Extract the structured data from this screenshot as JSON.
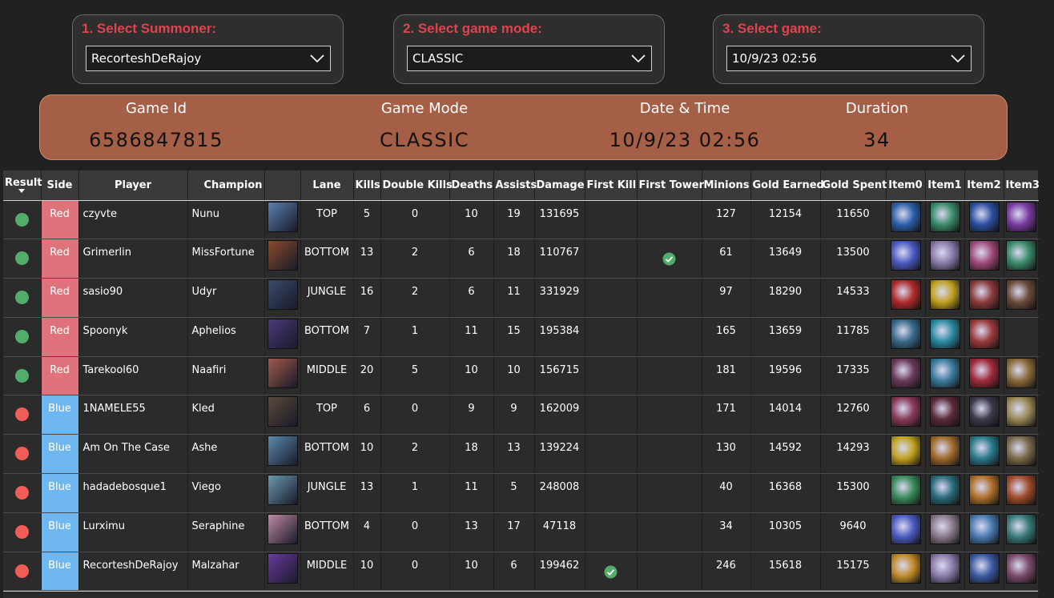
{
  "slicers": [
    {
      "label": "1. Select Summoner:",
      "value": "RecorteshDeRajoy"
    },
    {
      "label": "2. Select game mode:",
      "value": "CLASSIC"
    },
    {
      "label": "3. Select game:",
      "value": "10/9/23 02:56"
    }
  ],
  "info": {
    "game_id_label": "Game Id",
    "game_id": "6586847815",
    "mode_label": "Game Mode",
    "mode": "CLASSIC",
    "date_label": "Date & Time",
    "date": "10/9/23 02:56",
    "duration_label": "Duration",
    "duration": "34"
  },
  "columns": [
    "Result",
    "Side",
    "Player",
    "Champion",
    "",
    "Lane",
    "Kills",
    "Double Kills",
    "Deaths",
    "Assists",
    "Damage",
    "First Kill",
    "First Tower",
    "Minions",
    "Gold Earned",
    "Gold Spent",
    "Item0",
    "Item1",
    "Item2",
    "Item3"
  ],
  "colors": {
    "win": "#52ad6a",
    "loss": "#f05d56",
    "red_side": "#e0727b",
    "blue_side": "#6fb7f0",
    "banner": "#a65f47",
    "label_red": "#e0434d"
  },
  "rows": [
    {
      "result": "win",
      "side": "Red",
      "player": "czyvte",
      "champion": "Nunu",
      "champ_color": "#5a7fb0",
      "lane": "TOP",
      "kills": "5",
      "double_kills": "0",
      "deaths": "10",
      "assists": "19",
      "damage": "131695",
      "first_kill": false,
      "first_tower": false,
      "minions": "127",
      "gold_earned": "12154",
      "gold_spent": "11650",
      "items": [
        "#2b5fa8",
        "#3a8a6a",
        "#2a4ea0",
        "#7a3aa0"
      ]
    },
    {
      "result": "win",
      "side": "Red",
      "player": "Grimerlin",
      "champion": "MissFortune",
      "champ_color": "#8a4a2a",
      "lane": "BOTTOM",
      "kills": "13",
      "double_kills": "2",
      "deaths": "6",
      "assists": "18",
      "damage": "110767",
      "first_kill": false,
      "first_tower": true,
      "minions": "61",
      "gold_earned": "13649",
      "gold_spent": "13500",
      "items": [
        "#4a5ac0",
        "#8a7aa8",
        "#a04a7a",
        "#3a8a6a"
      ]
    },
    {
      "result": "win",
      "side": "Red",
      "player": "sasio90",
      "champion": "Udyr",
      "champ_color": "#3a4a6a",
      "lane": "JUNGLE",
      "kills": "16",
      "double_kills": "2",
      "deaths": "6",
      "assists": "11",
      "damage": "331929",
      "first_kill": false,
      "first_tower": false,
      "minions": "97",
      "gold_earned": "18290",
      "gold_spent": "14533",
      "items": [
        "#b02a2a",
        "#c0a020",
        "#8a3a3a",
        "#6a4a3a"
      ]
    },
    {
      "result": "win",
      "side": "Red",
      "player": "Spoonyk",
      "champion": "Aphelios",
      "champ_color": "#4a3a7a",
      "lane": "BOTTOM",
      "kills": "7",
      "double_kills": "1",
      "deaths": "11",
      "assists": "15",
      "damage": "195384",
      "first_kill": false,
      "first_tower": false,
      "minions": "165",
      "gold_earned": "13659",
      "gold_spent": "11785",
      "items": [
        "#3a6a8a",
        "#2a8aa0",
        "#9a3a3a",
        ""
      ]
    },
    {
      "result": "win",
      "side": "Red",
      "player": "Tarekool60",
      "champion": "Naafiri",
      "champ_color": "#a05a4a",
      "lane": "MIDDLE",
      "kills": "20",
      "double_kills": "5",
      "deaths": "10",
      "assists": "10",
      "damage": "156715",
      "first_kill": false,
      "first_tower": false,
      "minions": "181",
      "gold_earned": "19596",
      "gold_spent": "17335",
      "items": [
        "#6a3a5a",
        "#3a7a9a",
        "#a02a3a",
        "#8a6a3a"
      ]
    },
    {
      "result": "loss",
      "side": "Blue",
      "player": "1NAMELE55",
      "champion": "Kled",
      "champ_color": "#5a4a3a",
      "lane": "TOP",
      "kills": "6",
      "double_kills": "0",
      "deaths": "9",
      "assists": "9",
      "damage": "162009",
      "first_kill": false,
      "first_tower": false,
      "minions": "171",
      "gold_earned": "14014",
      "gold_spent": "12760",
      "items": [
        "#8a3a5a",
        "#5a2a3a",
        "#3a3a4a",
        "#9a8a5a"
      ]
    },
    {
      "result": "loss",
      "side": "Blue",
      "player": "Am On The Case",
      "champion": "Ashe",
      "champ_color": "#5a8ab0",
      "lane": "BOTTOM",
      "kills": "10",
      "double_kills": "2",
      "deaths": "18",
      "assists": "13",
      "damage": "139224",
      "first_kill": false,
      "first_tower": false,
      "minions": "130",
      "gold_earned": "14592",
      "gold_spent": "14293",
      "items": [
        "#c0a020",
        "#a06a2a",
        "#2a7a8a",
        "#7a6a4a"
      ]
    },
    {
      "result": "loss",
      "side": "Blue",
      "player": "hadadebosque1",
      "champion": "Viego",
      "champ_color": "#6a9ab0",
      "lane": "JUNGLE",
      "kills": "13",
      "double_kills": "1",
      "deaths": "11",
      "assists": "5",
      "damage": "248008",
      "first_kill": false,
      "first_tower": false,
      "minions": "40",
      "gold_earned": "16368",
      "gold_spent": "15300",
      "items": [
        "#3a8a5a",
        "#2a6a7a",
        "#b0702a",
        "#a04a2a"
      ]
    },
    {
      "result": "loss",
      "side": "Blue",
      "player": "Lurximu",
      "champion": "Seraphine",
      "champ_color": "#c08aa0",
      "lane": "BOTTOM",
      "kills": "4",
      "double_kills": "0",
      "deaths": "13",
      "assists": "17",
      "damage": "47118",
      "first_kill": false,
      "first_tower": false,
      "minions": "34",
      "gold_earned": "10305",
      "gold_spent": "9640",
      "items": [
        "#4a5ac0",
        "#8a7a8a",
        "#4a7ab0",
        "#3a7a7a"
      ]
    },
    {
      "result": "loss",
      "side": "Blue",
      "player": "RecorteshDeRajoy",
      "champion": "Malzahar",
      "champ_color": "#6a3aa0",
      "lane": "MIDDLE",
      "kills": "10",
      "double_kills": "0",
      "deaths": "10",
      "assists": "6",
      "damage": "199462",
      "first_kill": true,
      "first_tower": false,
      "minions": "246",
      "gold_earned": "15618",
      "gold_spent": "15175",
      "items": [
        "#c08a2a",
        "#8a7aa8",
        "#3a5aa0",
        "#7a4a6a"
      ]
    }
  ]
}
